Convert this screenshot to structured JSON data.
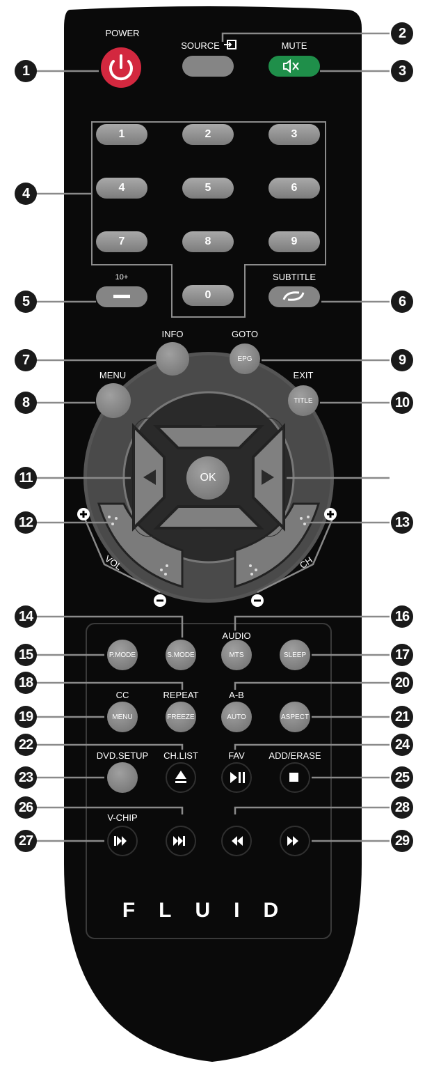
{
  "colors": {
    "body": "#0a0a0a",
    "button": "#8a8a8a",
    "power": "#d3283f",
    "mute": "#1f8f4a",
    "callout": "#1a1a1a",
    "leader": "#888888"
  },
  "labels": {
    "power": "POWER",
    "source": "SOURCE",
    "mute": "MUTE",
    "ten_plus": "10+",
    "subtitle": "SUBTITLE",
    "info": "INFO",
    "goto": "GOTO",
    "menu": "MENU",
    "exit": "EXIT",
    "vol": "VOL",
    "ch": "CH",
    "audio": "AUDIO",
    "cc": "CC",
    "repeat": "REPEAT",
    "a_b": "A-B",
    "dvd_setup": "DVD.SETUP",
    "ch_list": "CH.LIST",
    "fav": "FAV",
    "add_erase": "ADD/ERASE",
    "v_chip": "V-CHIP",
    "brand": "FLUID"
  },
  "buttons": {
    "digits": [
      "1",
      "2",
      "3",
      "4",
      "5",
      "6",
      "7",
      "8",
      "9",
      "0"
    ],
    "epg": "EPG",
    "title": "TITLE",
    "ok": "OK",
    "p_mode": "P.MODE",
    "s_mode": "S.MODE",
    "mts": "MTS",
    "sleep": "SLEEP",
    "menu2": "MENU",
    "freeze": "FREEZE",
    "auto": "AUTO",
    "aspect": "ASPECT"
  },
  "callouts": [
    "1",
    "2",
    "3",
    "4",
    "5",
    "6",
    "7",
    "8",
    "9",
    "10",
    "11",
    "12",
    "13",
    "14",
    "15",
    "16",
    "17",
    "18",
    "19",
    "20",
    "21",
    "22",
    "23",
    "24",
    "25",
    "26",
    "27",
    "28",
    "29"
  ]
}
